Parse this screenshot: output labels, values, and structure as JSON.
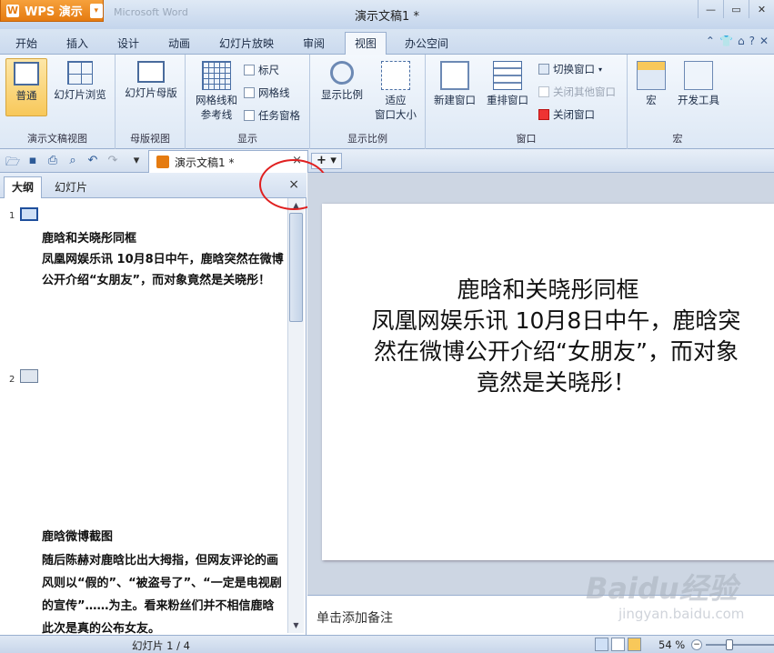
{
  "app": {
    "button_label": "WPS 演示",
    "ghost_title": "Microsoft Word",
    "window_title": "演示文稿1 *"
  },
  "menu_tabs": [
    "开始",
    "插入",
    "设计",
    "动画",
    "幻灯片放映",
    "审阅",
    "视图",
    "办公空间"
  ],
  "active_tab": "视图",
  "ribbon": {
    "group_presentation_view": {
      "label": "演示文稿视图",
      "normal": "普通",
      "slide_sorter": "幻灯片浏览"
    },
    "group_master_view": {
      "label": "母版视图",
      "slide_master": "幻灯片母版"
    },
    "group_show": {
      "label": "显示",
      "gridlines_guides_line1": "网格线和",
      "gridlines_guides_line2": "参考线",
      "ruler": "标尺",
      "gridlines": "网格线",
      "task_pane": "任务窗格"
    },
    "group_zoom": {
      "label": "显示比例",
      "zoom": "显示比例",
      "fit_line1": "适应",
      "fit_line2": "窗口大小"
    },
    "group_window": {
      "label": "窗口",
      "new_window": "新建窗口",
      "arrange": "重排窗口",
      "switch": "切换窗口",
      "close_others": "关闭其他窗口",
      "close_window": "关闭窗口"
    },
    "group_macro": {
      "label": "宏",
      "macro": "宏",
      "developer": "开发工具"
    }
  },
  "doc_tab": {
    "label": "演示文稿1 *",
    "close": "×"
  },
  "add_tab": "+ ▾",
  "left_pane": {
    "tab_outline": "大纲",
    "tab_slides": "幻灯片",
    "close": "×",
    "slides": [
      {
        "num": "1",
        "title": "鹿晗和关晓彤同框",
        "body": "凤凰网娱乐讯 10月8日中午，鹿晗突然在微博公开介绍“女朋友”，而对象竟然是关晓彤！"
      },
      {
        "num": "2",
        "title": "鹿晗微博截图",
        "body": "随后陈赫对鹿晗比出大拇指，但网友评论的画风则以“假的”、“被盗号了”、“一定是电视剧的宣传”……为主。看来粉丝们并不相信鹿晗此次是真的公布女友。"
      }
    ]
  },
  "slide": {
    "title": "鹿晗和关晓彤同框",
    "body": "凤凰网娱乐讯 10月8日中午，鹿晗突然在微博公开介绍“女朋友”，而对象竟然是关晓彤！"
  },
  "notes_placeholder": "单击添加备注",
  "status": {
    "slide_count": "幻灯片 1 / 4",
    "zoom": "54 %"
  },
  "watermark": {
    "brand": "Baidu经验",
    "url": "jingyan.baidu.com"
  },
  "colors": {
    "accent": "#e57b10",
    "ribbon_border": "#99afcf",
    "annotation": "#e02020"
  }
}
